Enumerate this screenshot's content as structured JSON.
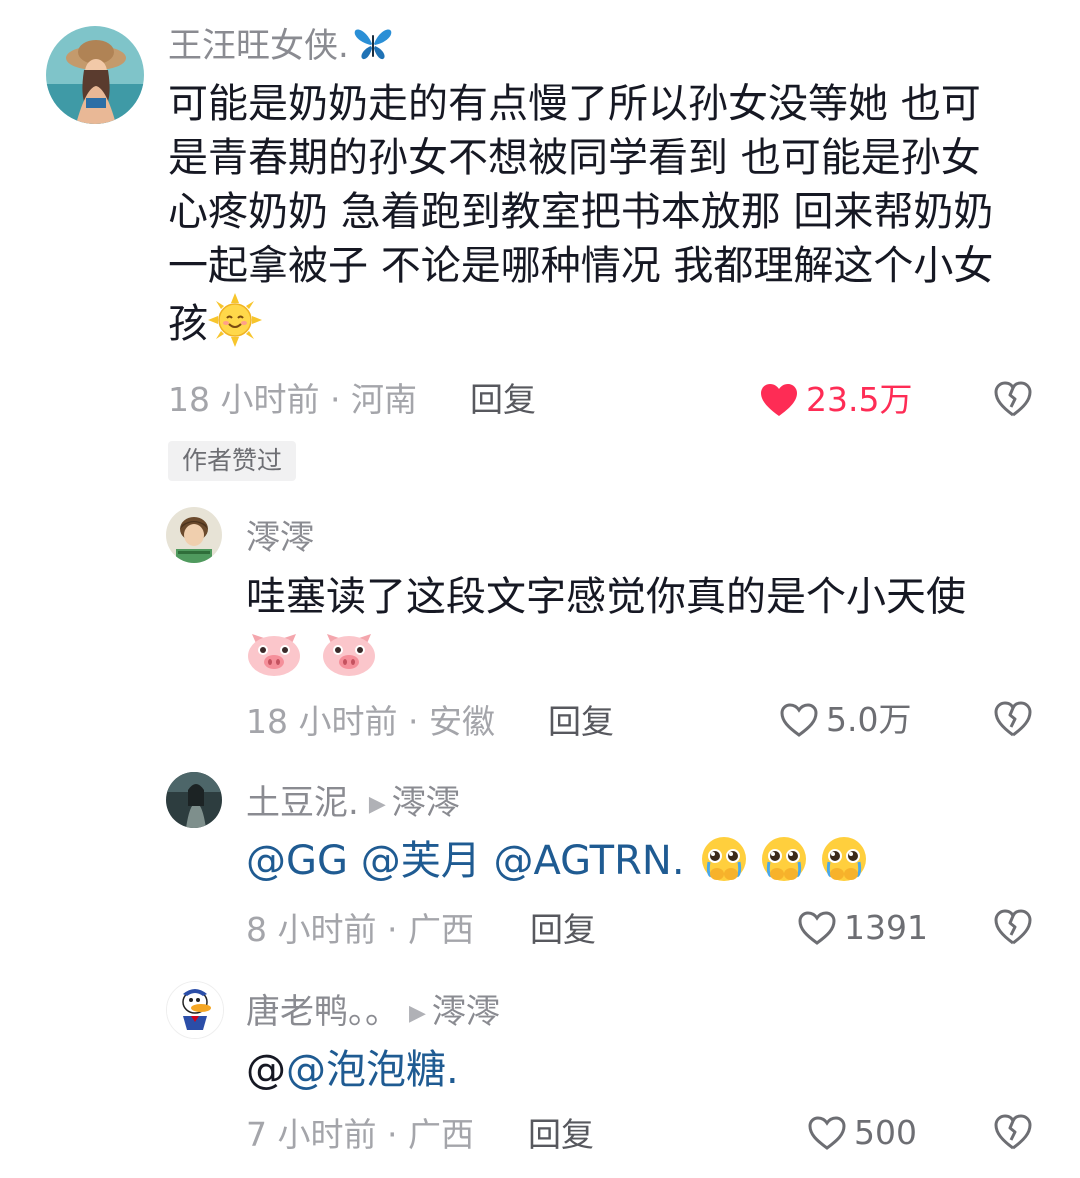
{
  "comments": [
    {
      "author": "王汪旺女侠.",
      "text": "可能是奶奶走的有点慢了所以孙女没等她 也可是青春期的孙女不想被同学看到 也可能是孙女心疼奶奶 急着跑到教室把书本放那 回来帮奶奶一起拿被子 不论是哪种情况 我都理解这个小女孩",
      "lines": [
        "可能是奶奶走的有点慢了所以孙女没等她 也可",
        "是青春期的孙女不想被同学看到 也可能是孙女",
        "心疼奶奶 急着跑到教室把书本放那 回来帮奶奶",
        "一起拿被子 不论是哪种情况 我都理解这个小女",
        "孩"
      ],
      "time_location": "18 小时前 · 河南",
      "reply_label": "回复",
      "likes": "23.5万",
      "liked": true,
      "badge": "作者赞过",
      "emoji": "sun-smile-icon"
    }
  ],
  "replies": [
    {
      "author": "澪澪",
      "text": "哇塞读了这段文字感觉你真的是个小天使",
      "emoji": "pig-face-icon",
      "time_location": "18 小时前 · 安徽",
      "reply_label": "回复",
      "likes": "5.0万"
    },
    {
      "author": "土豆泥.",
      "reply_to": "澪澪",
      "mentions": [
        "@GG",
        "@芙月",
        "@AGTRN."
      ],
      "emoji": "pleading-face-icon",
      "time_location": "8 小时前 · 广西",
      "reply_label": "回复",
      "likes": "1391"
    },
    {
      "author": "唐老鸭。。",
      "reply_to": "澪澪",
      "text_prefix": "@",
      "mention": "@泡泡糖.",
      "time_location": "7 小时前 · 广西",
      "reply_label": "回复",
      "likes": "500"
    }
  ],
  "colors": {
    "like_active": "#fe2c55",
    "mention": "#1f5b92",
    "meta": "#a4a5aa"
  }
}
